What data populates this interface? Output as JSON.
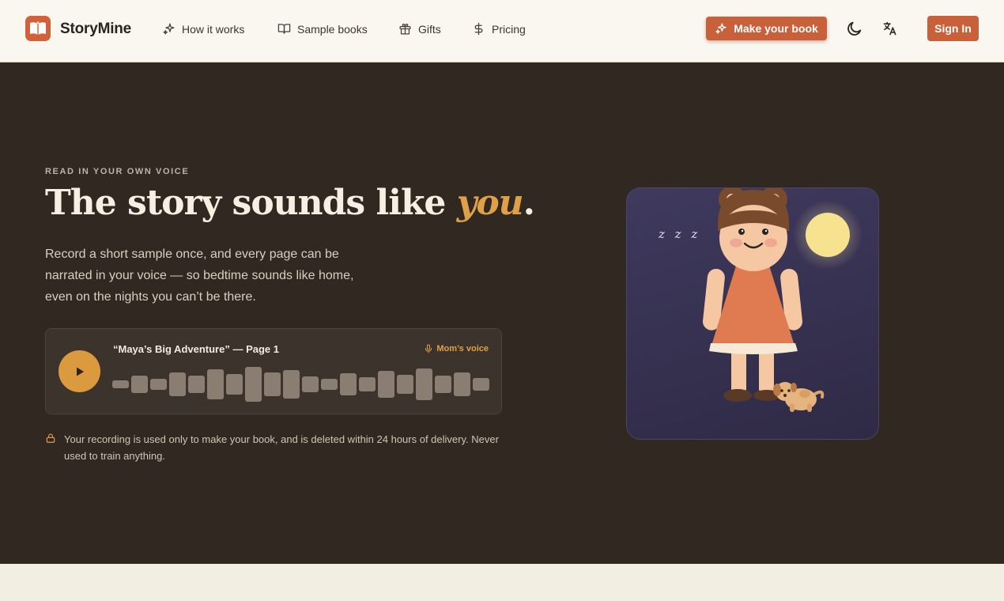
{
  "brand": {
    "name": "StoryMine",
    "accent_color": "#d1613b"
  },
  "nav": {
    "items": [
      {
        "label": "How it works",
        "icon": "sparkles-icon"
      },
      {
        "label": "Sample books",
        "icon": "book-open-icon"
      },
      {
        "label": "Gifts",
        "icon": "gift-icon"
      },
      {
        "label": "Pricing",
        "icon": "dollar-icon"
      }
    ],
    "cta_label": "Make your book",
    "theme_icon": "moon-icon",
    "language_icon": "translate-icon",
    "signin_label": "Sign In"
  },
  "hero": {
    "eyebrow": "READ IN YOUR OWN VOICE",
    "headline_main": "The story sounds like ",
    "headline_accent": "you",
    "headline_end": ".",
    "subcopy": "Record a short sample once, and every page can be narrated in your voice — so bedtime sounds like home, even on the nights you can’t be there.",
    "player": {
      "title": "“Maya’s Big Adventure” — Page 1",
      "voice_label": "Mom’s voice",
      "waveform_levels": [
        0.23,
        0.5,
        0.32,
        0.68,
        0.5,
        0.86,
        0.59,
        1.0,
        0.68,
        0.82,
        0.45,
        0.32,
        0.64,
        0.41,
        0.77,
        0.55,
        0.91,
        0.5,
        0.68,
        0.36
      ]
    },
    "privacy_note": "Your recording is used only to make your book, and is deleted within 24 hours of delivery. Never used to train anything.",
    "illustration": {
      "sleep_text": "z z z"
    }
  },
  "colors": {
    "hero_bg": "#302821",
    "accent_orange": "#c8603a",
    "accent_gold": "#e0a04a"
  }
}
